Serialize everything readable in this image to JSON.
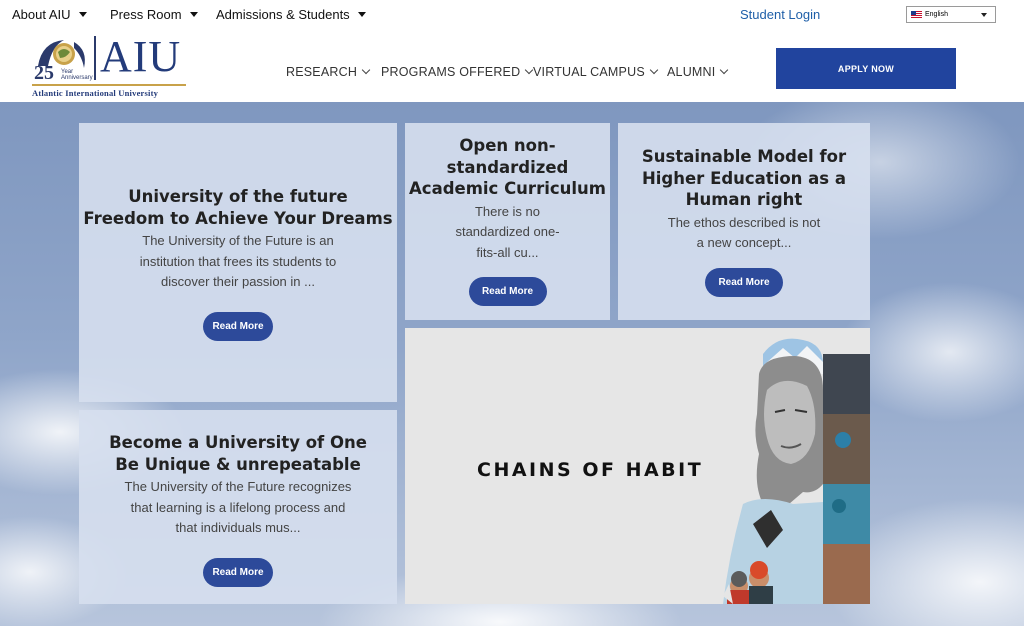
{
  "topbar": {
    "menus": [
      {
        "label": "About AIU"
      },
      {
        "label": "Press Room"
      },
      {
        "label": "Admissions & Students"
      }
    ],
    "student_login": "Student Login",
    "language": {
      "selected": "English",
      "icon": "us-flag-icon"
    }
  },
  "header": {
    "logo": {
      "anniversary_number": "25",
      "anniversary_text": "Year Anniversary",
      "wordmark": "AIU",
      "full_name": "Atlantic International University"
    },
    "nav": [
      {
        "label": "RESEARCH"
      },
      {
        "label": "PROGRAMS OFFERED"
      },
      {
        "label": "VIRTUAL CAMPUS"
      },
      {
        "label": "ALUMNI"
      }
    ],
    "apply_label": "APPLY NOW"
  },
  "cards": [
    {
      "title_lines": [
        "University of the future",
        "Freedom to Achieve Your Dreams"
      ],
      "text_lines": [
        "The University of the Future is an",
        "institution that frees its students to",
        "discover their passion in ..."
      ],
      "button": "Read More"
    },
    {
      "title_lines": [
        "Open non-",
        "standardized",
        "Academic Curriculum"
      ],
      "text_lines": [
        "There is no",
        "standardized one-",
        "fits-all cu..."
      ],
      "button": "Read More"
    },
    {
      "title_lines": [
        "Sustainable Model for",
        "Higher Education as a",
        "Human right"
      ],
      "text_lines": [
        "The ethos described is not",
        "a new concept..."
      ],
      "button": "Read More"
    },
    {
      "title_lines": [
        "Become a University of One",
        "Be Unique & unrepeatable"
      ],
      "text_lines": [
        "The University of the Future recognizes",
        "that learning is a lifelong process and",
        "that individuals mus..."
      ],
      "button": "Read More"
    }
  ],
  "promo": {
    "title": "CHAINS OF HABIT"
  },
  "colors": {
    "brand_blue": "#21449e",
    "button_blue": "#2d4a9a",
    "link_blue": "#1f5fa8"
  }
}
